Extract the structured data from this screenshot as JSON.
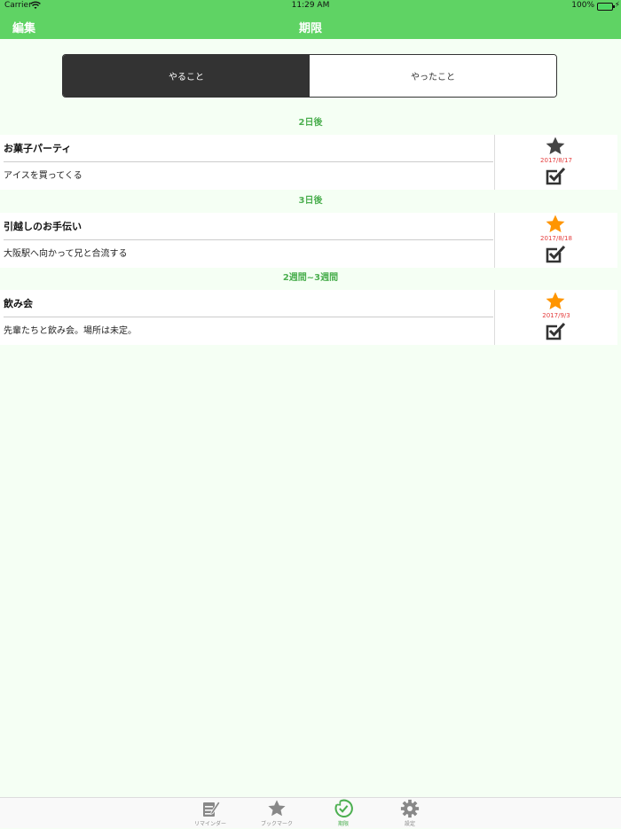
{
  "status_bar": {
    "carrier": "Carrier",
    "time": "11:29 AM",
    "battery": "100%"
  },
  "nav": {
    "edit_label": "編集",
    "title": "期限"
  },
  "segments": [
    {
      "label": "やること",
      "selected": true
    },
    {
      "label": "やったこと",
      "selected": false
    }
  ],
  "sections": [
    {
      "header": "2日後",
      "items": [
        {
          "title": "お菓子パーティ",
          "description": "アイスを買ってくる",
          "date": "2017/8/17",
          "star_color": "#444444"
        }
      ]
    },
    {
      "header": "3日後",
      "items": [
        {
          "title": "引越しのお手伝い",
          "description": "大阪駅へ向かって兄と合流する",
          "date": "2017/8/18",
          "star_color": "#ff9500"
        }
      ]
    },
    {
      "header": "2週間~3週間",
      "items": [
        {
          "title": "飲み会",
          "description": "先輩たちと飲み会。場所は未定。",
          "date": "2017/9/3",
          "star_color": "#ff9500"
        }
      ]
    }
  ],
  "tabs": [
    {
      "label": "リマインダー",
      "icon": "reminder-icon",
      "active": false
    },
    {
      "label": "ブックマーク",
      "icon": "star-icon",
      "active": false
    },
    {
      "label": "期限",
      "icon": "deadline-clock-icon",
      "active": true
    },
    {
      "label": "設定",
      "icon": "gear-icon",
      "active": false
    }
  ],
  "colors": {
    "accent": "#5fd364",
    "section_header": "#4caf50",
    "date": "#e43c3c"
  }
}
